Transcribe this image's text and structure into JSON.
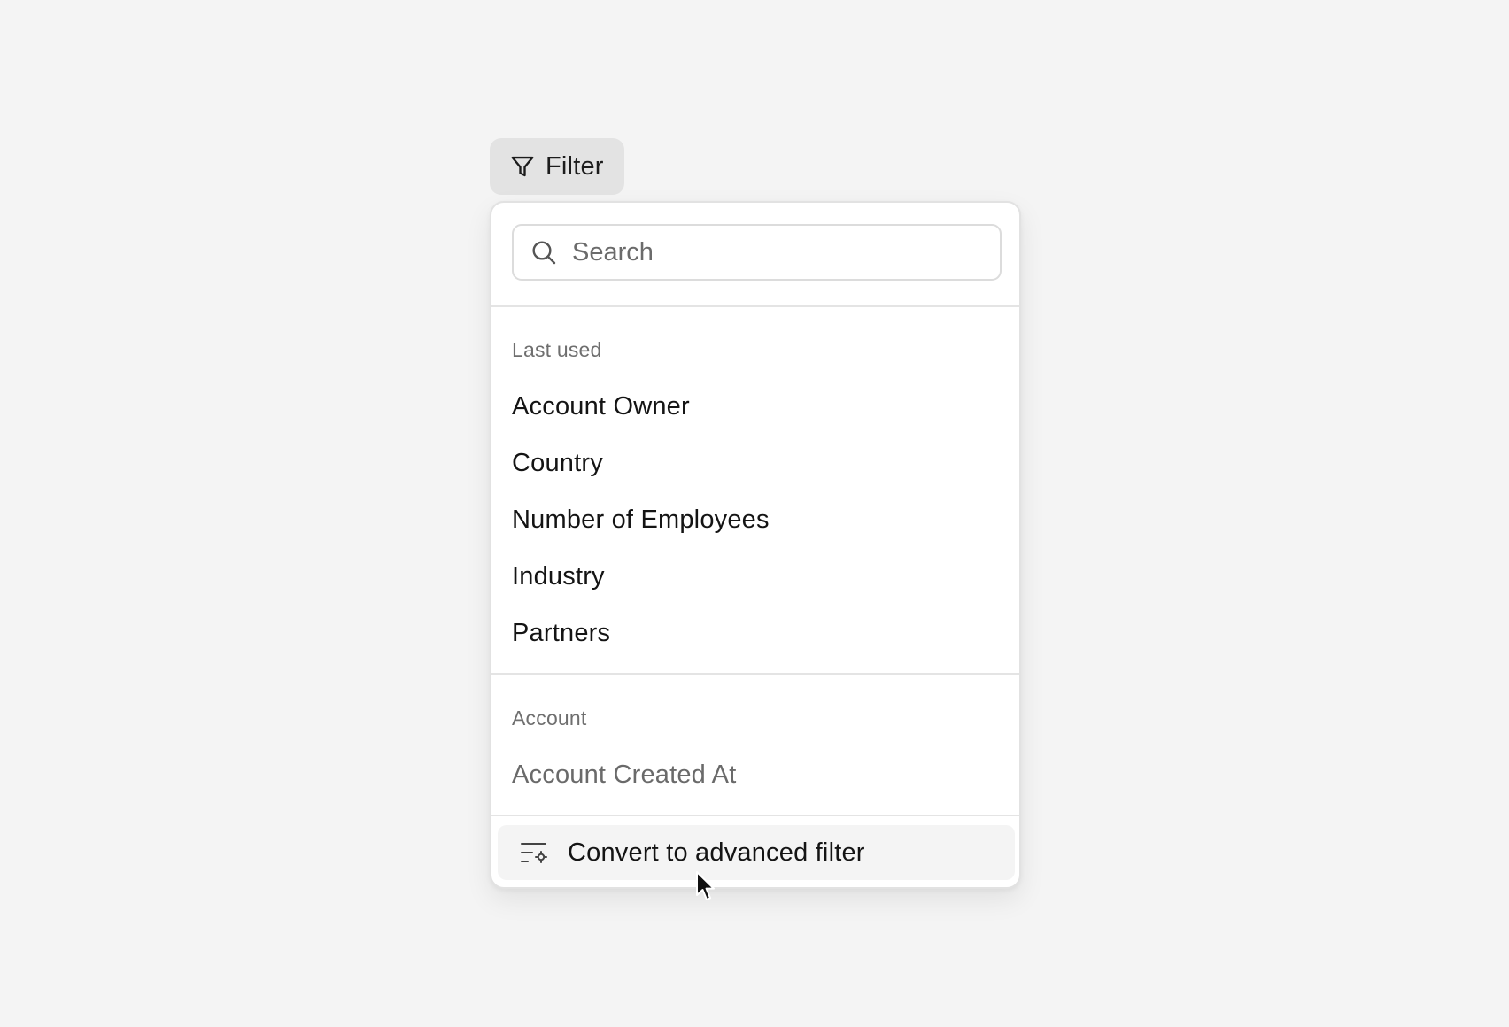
{
  "filter_button": {
    "label": "Filter",
    "icon": "funnel-icon"
  },
  "dropdown": {
    "search": {
      "placeholder": "Search",
      "value": "",
      "icon": "search-icon"
    },
    "sections": [
      {
        "label": "Last used",
        "items": [
          "Account Owner",
          "Country",
          "Number of Employees",
          "Industry",
          "Partners"
        ]
      },
      {
        "label": "Account",
        "items": [
          "Account Created At"
        ]
      }
    ],
    "footer_action": {
      "label": "Convert to advanced filter",
      "icon": "filter-settings-icon"
    }
  },
  "colors": {
    "page_background": "#f4f4f4",
    "button_background": "#e3e3e3",
    "panel_background": "#ffffff",
    "hover_background": "#f4f4f4",
    "muted_text": "#6f6f6f"
  }
}
